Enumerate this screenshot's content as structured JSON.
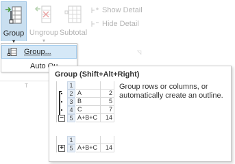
{
  "ribbon": {
    "group_label": "Group",
    "ungroup_label": "Ungroup",
    "subtotal_label": "Subtotal",
    "dropdown_caret": "▾",
    "show_detail_label": "Show Detail",
    "hide_detail_label": "Hide Detail",
    "launcher_glyph": "◹"
  },
  "menu": {
    "items": [
      {
        "label": "Group...",
        "icon": "group-rows-icon",
        "highlighted": true
      },
      {
        "label": "Auto Outline",
        "icon": "",
        "highlighted": false
      }
    ],
    "auto_outline_visible": "Auto Ou"
  },
  "sheet": {
    "col_letter": "T"
  },
  "tooltip": {
    "title": "Group (Shift+Alt+Right)",
    "description": "Group rows or columns, or automatically create an outline.",
    "example_expanded": {
      "header_row": "1",
      "rows": [
        {
          "num": "2",
          "a": "A",
          "b": "2"
        },
        {
          "num": "3",
          "a": "B",
          "b": "5"
        },
        {
          "num": "4",
          "a": "C",
          "b": "7"
        }
      ],
      "total": {
        "num": "5",
        "a": "A+B+C",
        "b": "14",
        "toggle": "−"
      }
    },
    "example_collapsed": {
      "header_row": "1",
      "total": {
        "num": "5",
        "a": "A+B+C",
        "b": "14",
        "toggle": "+"
      }
    }
  },
  "colors": {
    "accent": "#c9dff0",
    "highlight": "#d5e8f7",
    "disabled_text": "#b4b4b4",
    "icon_green": "#4a9a3c"
  }
}
